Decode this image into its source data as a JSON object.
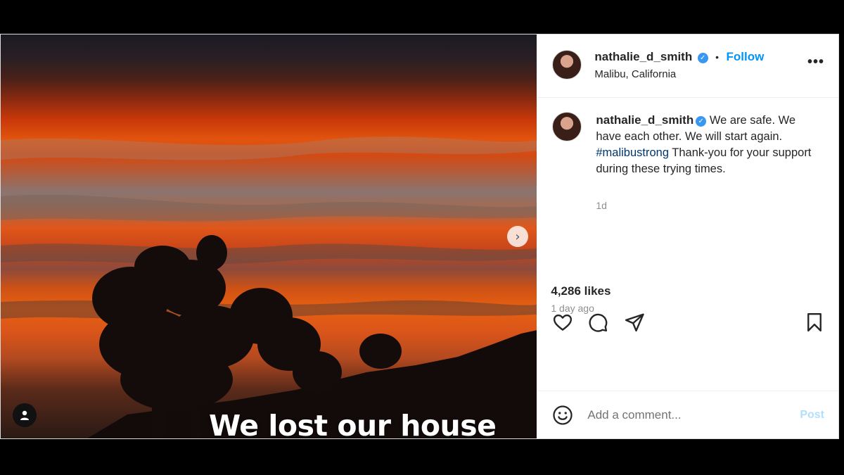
{
  "post": {
    "media": {
      "overlay_text": "We lost our house",
      "icons": {
        "next": "chevron-right-icon",
        "tagged": "person-icon"
      }
    },
    "header": {
      "username": "nathalie_d_smith",
      "separator": "•",
      "follow_label": "Follow",
      "location": "Malibu, California",
      "more_icon": "more-horizontal-icon"
    },
    "caption": {
      "username": "nathalie_d_smith",
      "text_before": "We are safe. We have each other. We will start again.",
      "hashtag": "#malibustrong",
      "text_after": "Thank-you for your support during these trying times.",
      "time": "1d"
    },
    "actions": {
      "icons": [
        "heart-icon",
        "comment-icon",
        "share-icon",
        "bookmark-icon"
      ]
    },
    "likes": "4,286 likes",
    "posted_ago": "1 day ago",
    "comment": {
      "placeholder": "Add a comment...",
      "post_label": "Post",
      "emoji_icon": "emoji-icon"
    }
  },
  "colors": {
    "follow": "#0095f6",
    "verified": "#3897f0",
    "hashtag": "#00376b",
    "post_disabled": "#b2dffc"
  }
}
